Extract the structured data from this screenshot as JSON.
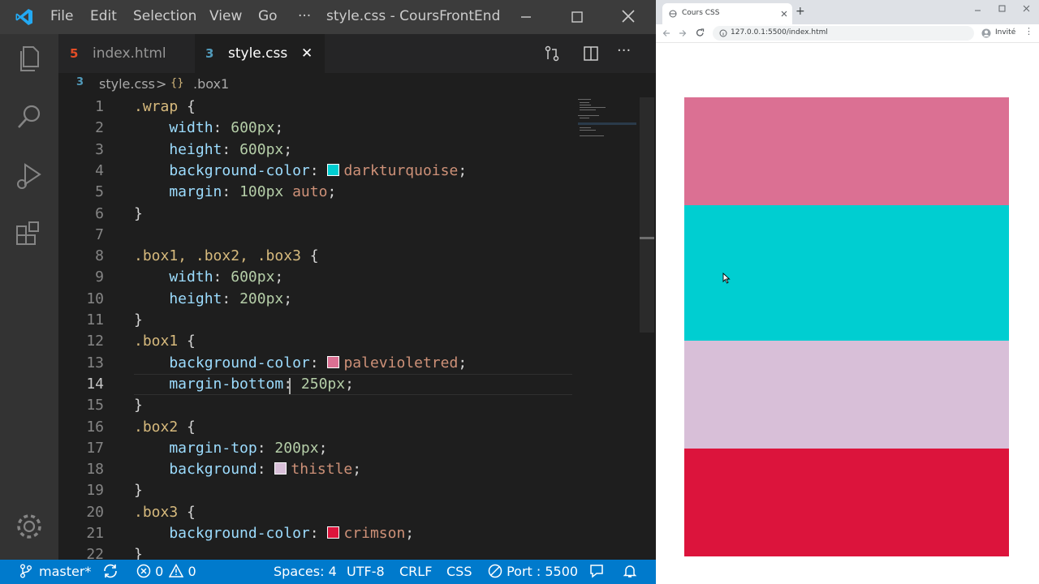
{
  "titlebar": {
    "menus": [
      "File",
      "Edit",
      "Selection",
      "View",
      "Go"
    ],
    "more": "···",
    "title": "style.css - CoursFrontEnd - ..."
  },
  "tabs": [
    {
      "label": "index.html",
      "icon": "html5-icon"
    },
    {
      "label": "style.css",
      "icon": "css3-icon",
      "active": true,
      "close": "✕"
    }
  ],
  "breadcrumb": {
    "file": "style.css",
    "separator": ">",
    "symbol": ".box1"
  },
  "editor": {
    "line_numbers": [
      "1",
      "2",
      "3",
      "4",
      "5",
      "6",
      "7",
      "8",
      "9",
      "10",
      "11",
      "12",
      "13",
      "14",
      "15",
      "16",
      "17",
      "18",
      "19",
      "20",
      "21",
      "22"
    ],
    "lines": [
      [
        {
          "t": ".wrap",
          "c": "sel"
        },
        {
          "t": " {",
          "c": "plain"
        }
      ],
      [
        {
          "t": "    width",
          "c": "prop"
        },
        {
          "t": ": ",
          "c": "plain"
        },
        {
          "t": "600px",
          "c": "num"
        },
        {
          "t": ";",
          "c": "plain"
        }
      ],
      [
        {
          "t": "    height",
          "c": "prop"
        },
        {
          "t": ": ",
          "c": "plain"
        },
        {
          "t": "600px",
          "c": "num"
        },
        {
          "t": ";",
          "c": "plain"
        }
      ],
      [
        {
          "t": "    background-color",
          "c": "prop"
        },
        {
          "t": ": ",
          "c": "plain"
        },
        {
          "swatch": "#00ced1"
        },
        {
          "t": "darkturquoise",
          "c": "val"
        },
        {
          "t": ";",
          "c": "plain"
        }
      ],
      [
        {
          "t": "    margin",
          "c": "prop"
        },
        {
          "t": ": ",
          "c": "plain"
        },
        {
          "t": "100px",
          "c": "num"
        },
        {
          "t": " ",
          "c": "plain"
        },
        {
          "t": "auto",
          "c": "val"
        },
        {
          "t": ";",
          "c": "plain"
        }
      ],
      [
        {
          "t": "}",
          "c": "plain"
        }
      ],
      [],
      [
        {
          "t": ".box1, .box2, .box3",
          "c": "sel"
        },
        {
          "t": " {",
          "c": "plain"
        }
      ],
      [
        {
          "t": "    width",
          "c": "prop"
        },
        {
          "t": ": ",
          "c": "plain"
        },
        {
          "t": "600px",
          "c": "num"
        },
        {
          "t": ";",
          "c": "plain"
        }
      ],
      [
        {
          "t": "    height",
          "c": "prop"
        },
        {
          "t": ": ",
          "c": "plain"
        },
        {
          "t": "200px",
          "c": "num"
        },
        {
          "t": ";",
          "c": "plain"
        }
      ],
      [
        {
          "t": "}",
          "c": "plain"
        }
      ],
      [
        {
          "t": ".box1",
          "c": "sel"
        },
        {
          "t": " {",
          "c": "plain"
        }
      ],
      [
        {
          "t": "    background-color",
          "c": "prop"
        },
        {
          "t": ": ",
          "c": "plain"
        },
        {
          "swatch": "#db7093"
        },
        {
          "t": "palevioletred",
          "c": "val"
        },
        {
          "t": ";",
          "c": "plain"
        }
      ],
      [
        {
          "t": "    margin-bottom",
          "c": "prop"
        },
        {
          "t": ": ",
          "c": "plain"
        },
        {
          "t": "250px",
          "c": "num"
        },
        {
          "t": ";",
          "c": "plain"
        }
      ],
      [
        {
          "t": "}",
          "c": "plain"
        }
      ],
      [
        {
          "t": ".box2",
          "c": "sel"
        },
        {
          "t": " {",
          "c": "plain"
        }
      ],
      [
        {
          "t": "    margin-top",
          "c": "prop"
        },
        {
          "t": ": ",
          "c": "plain"
        },
        {
          "t": "200px",
          "c": "num"
        },
        {
          "t": ";",
          "c": "plain"
        }
      ],
      [
        {
          "t": "    background",
          "c": "prop"
        },
        {
          "t": ": ",
          "c": "plain"
        },
        {
          "swatch": "#d8bfd8"
        },
        {
          "t": "thistle",
          "c": "val"
        },
        {
          "t": ";",
          "c": "plain"
        }
      ],
      [
        {
          "t": "}",
          "c": "plain"
        }
      ],
      [
        {
          "t": ".box3",
          "c": "sel"
        },
        {
          "t": " {",
          "c": "plain"
        }
      ],
      [
        {
          "t": "    background-color",
          "c": "prop"
        },
        {
          "t": ": ",
          "c": "plain"
        },
        {
          "swatch": "#dc143c"
        },
        {
          "t": "crimson",
          "c": "val"
        },
        {
          "t": ";",
          "c": "plain"
        }
      ],
      [
        {
          "t": "}",
          "c": "plain"
        }
      ]
    ]
  },
  "statusbar": {
    "branch": "master*",
    "errors": "0",
    "warnings": "0",
    "spaces": "Spaces: 4",
    "encoding": "UTF-8",
    "eol": "CRLF",
    "language": "CSS",
    "port": "Port : 5500"
  },
  "browser": {
    "tab_title": "Cours CSS",
    "new_tab": "+",
    "url": "127.0.0.1:5500/index.html",
    "profile": "Invité",
    "boxes": [
      {
        "name": "box1",
        "color": "#db7093"
      },
      {
        "name": "wrap",
        "color": "#00ced1"
      },
      {
        "name": "box2",
        "color": "#d8bfd8"
      },
      {
        "name": "box3",
        "color": "#dc143c"
      }
    ]
  },
  "colors": {
    "accent": "#007acc",
    "titlebar": "#3c3c3c"
  }
}
